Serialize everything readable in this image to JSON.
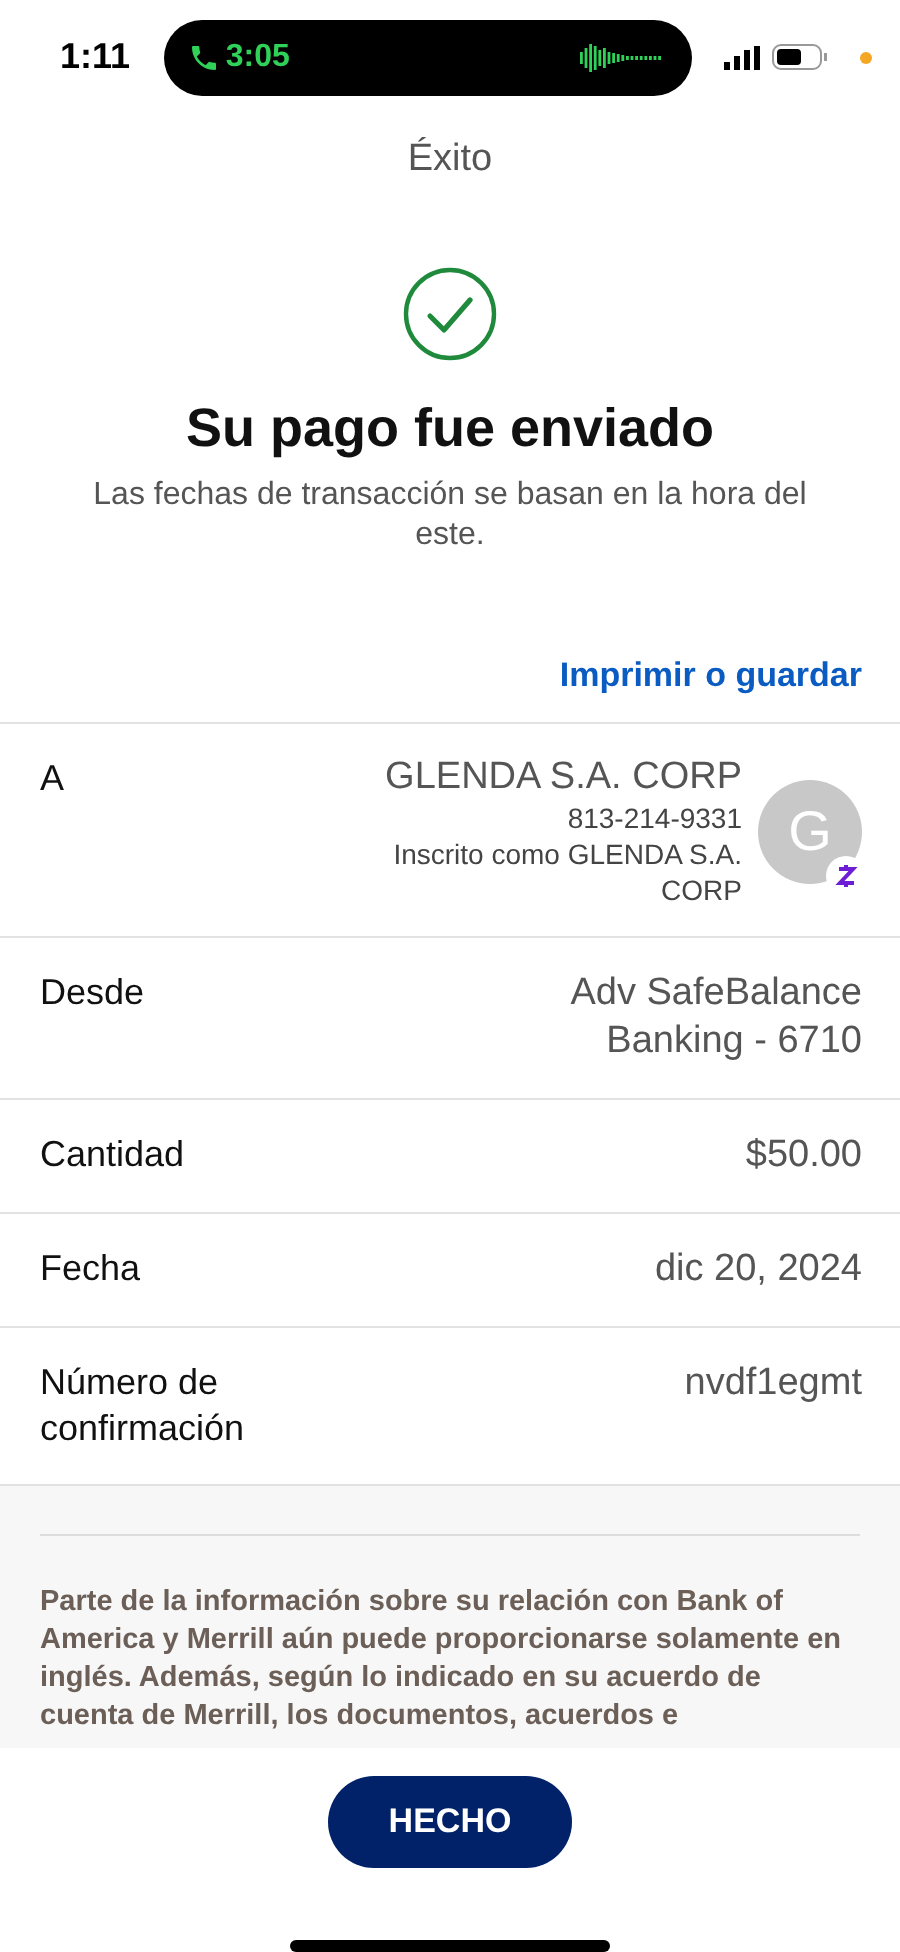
{
  "status_bar": {
    "time": "1:11",
    "call_time": "3:05"
  },
  "header": {
    "title": "Éxito"
  },
  "confirmation": {
    "title": "Su pago fue enviado",
    "subtitle": "Las fechas de transacción se basan en la hora del este."
  },
  "print_link": "Imprimir o guardar",
  "details": [
    {
      "kind": "recipient",
      "label": "A",
      "name": "GLENDA S.A. CORP",
      "phone": "813-214-9331",
      "enrolled": "Inscrito como GLENDA S.A. CORP",
      "avatar": "G"
    },
    {
      "kind": "text",
      "label": "Desde",
      "value": "Adv SafeBalance Banking - 6710"
    },
    {
      "kind": "text",
      "label": "Cantidad",
      "value": "$50.00"
    },
    {
      "kind": "text",
      "label": "Fecha",
      "value": "dic 20, 2024"
    },
    {
      "kind": "text",
      "label": "Número de confirmación",
      "value": "nvdf1egmt"
    }
  ],
  "disclaimer": "Parte de la información sobre su relación con Bank of America y Merrill aún puede proporcionarse solamente en inglés. Además, según lo indicado en su acuerdo de cuenta de Merrill, los documentos, acuerdos e",
  "done_button": "HECHO"
}
